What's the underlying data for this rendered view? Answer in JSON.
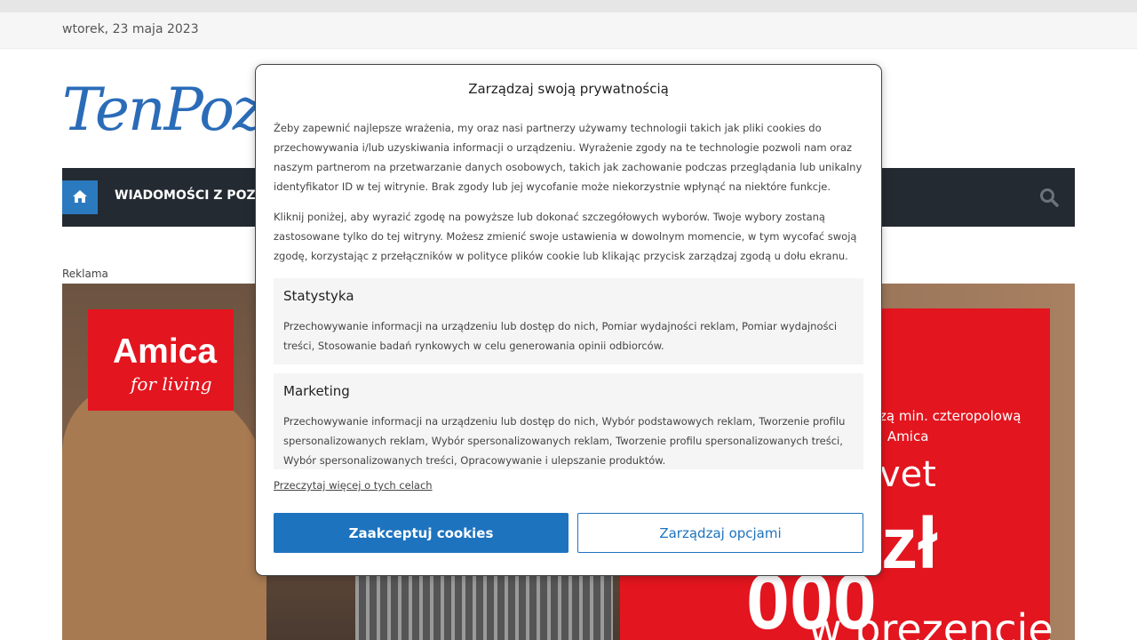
{
  "header": {
    "date": "wtorek, 23 maja 2023",
    "logo_text": "TenPoznań"
  },
  "nav": {
    "item_label": "WIADOMOŚCI Z POZNANIA"
  },
  "ad": {
    "label": "Reklama",
    "brand": "Amica",
    "tagline": "for living",
    "line1": "zą min. czteropolową",
    "line2": "i Amica",
    "line3": "vet",
    "line4": "zł",
    "line5": "000",
    "line6": "w prezencie"
  },
  "consent": {
    "title": "Zarządzaj swoją prywatnością",
    "intro": "Żeby zapewnić najlepsze wrażenia, my oraz nasi partnerzy używamy technologii takich jak pliki cookies do przechowywania i/lub uzyskiwania informacji o urządzeniu. Wyrażenie zgody na te technologie pozwoli nam oraz naszym partnerom na przetwarzanie danych osobowych, takich jak zachowanie podczas przeglądania lub unikalny identyfikator ID w tej witrynie. Brak zgody lub jej wycofanie może niekorzystnie wpłynąć na niektóre funkcje.",
    "instructions": "Kliknij poniżej, aby wyrazić zgodę na powyższe lub dokonać szczegółowych wyborów. Twoje wybory zostaną zastosowane tylko do tej witryny. Możesz zmienić swoje ustawienia w dowolnym momencie, w tym wycofać swoją zgodę, korzystając z przełączników w polityce plików cookie lub klikając przycisk zarządzaj zgodą u dołu ekranu.",
    "categories": [
      {
        "title": "Statystyka",
        "description": "Przechowywanie informacji na urządzeniu lub dostęp do nich, Pomiar wydajności reklam, Pomiar wydajności treści, Stosowanie badań rynkowych w celu generowania opinii odbiorców."
      },
      {
        "title": "Marketing",
        "description": "Przechowywanie informacji na urządzeniu lub dostęp do nich, Wybór podstawowych reklam, Tworzenie profilu spersonalizowanych reklam, Wybór spersonalizowanych reklam, Tworzenie profilu spersonalizowanych treści, Wybór spersonalizowanych treści, Opracowywanie i ulepszanie produktów."
      }
    ],
    "read_more": "Przeczytaj więcej o tych celach",
    "accept_label": "Zaakceptuj cookies",
    "manage_label": "Zarządzaj opcjami"
  }
}
